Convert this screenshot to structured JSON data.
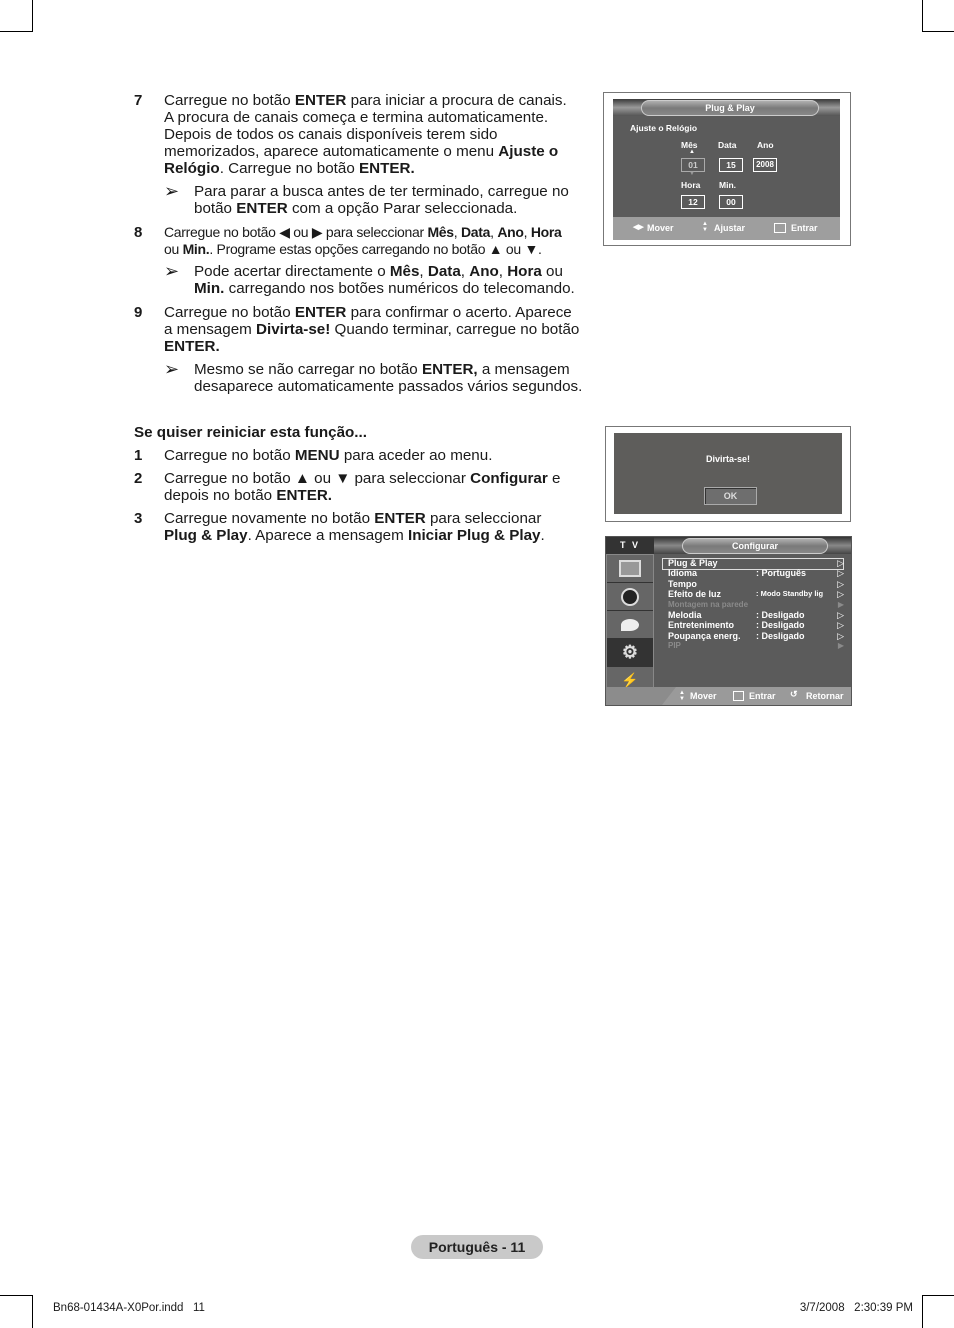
{
  "steps_a": [
    {
      "num": "7",
      "lines": [
        "Carregue no botão <b>ENTER</b> para iniciar a procura de canais.",
        "A procura de canais começa e termina automaticamente.",
        "Depois de todos os canais disponíveis terem sido",
        "memorizados, aparece automaticamente o menu <b>Ajuste o</b>",
        "<b>Relógio</b>. Carregue no botão <b>ENTER.</b>"
      ],
      "note": [
        "Para parar a busca antes de ter terminado, carregue no",
        "botão <b>ENTER</b> com a opção Parar seleccionada."
      ]
    },
    {
      "num": "8",
      "lines": [
        "Carregue no botão ◀ ou ▶ para seleccionar <b>Mês</b>, <b>Data</b>, <b>Ano</b>, <b>Hora</b>",
        "ou <b>Min.</b>. Programe estas opções carregando no botão ▲ ou ▼."
      ],
      "note": [
        "Pode acertar directamente o <b>Mês</b>, <b>Data</b>, <b>Ano</b>, <b>Hora</b> ou",
        "<b>Min.</b> carregando nos botões numéricos do telecomando."
      ]
    },
    {
      "num": "9",
      "lines": [
        "Carregue no botão <b>ENTER</b> para confirmar o acerto. Aparece",
        "a mensagem <b>Divirta-se!</b> Quando terminar, carregue no botão",
        "<b>ENTER.</b>"
      ],
      "note": [
        "Mesmo se não carregar no botão <b>ENTER,</b> a mensagem",
        "desaparece automaticamente passados vários segundos."
      ]
    }
  ],
  "section_b": {
    "heading": "Se quiser reiniciar esta função...",
    "steps": [
      {
        "num": "1",
        "lines": [
          "Carregue no botão <b>MENU</b> para aceder ao menu."
        ]
      },
      {
        "num": "2",
        "lines": [
          "Carregue no botão ▲ ou ▼ para seleccionar <b>Configurar</b> e",
          "depois no botão <b>ENTER.</b>"
        ]
      },
      {
        "num": "3",
        "lines": [
          "Carregue novamente no botão <b>ENTER</b> para seleccionar",
          "<b>Plug &amp; Play</b>. Aparece a mensagem <b>Iniciar Plug &amp; Play</b>."
        ]
      }
    ]
  },
  "clock_osd": {
    "title": "Plug & Play",
    "subtitle": "Ajuste o Relógio",
    "fields": {
      "mes_label": "Mês",
      "mes_value": "01",
      "data_label": "Data",
      "data_value": "15",
      "ano_label": "Ano",
      "ano_value": "2008",
      "hora_label": "Hora",
      "hora_value": "12",
      "min_label": "Min.",
      "min_value": "00"
    },
    "footer": {
      "move": "Mover",
      "adjust": "Ajustar",
      "enter": "Entrar"
    }
  },
  "message_osd": {
    "message": "Divirta-se!",
    "ok": "OK"
  },
  "setup_osd": {
    "source": "T V",
    "title": "Configurar",
    "items": [
      {
        "label": "Plug & Play",
        "value": "",
        "enabled": true,
        "selected": true
      },
      {
        "label": "Idioma",
        "value": ": Português",
        "enabled": true
      },
      {
        "label": "Tempo",
        "value": "",
        "enabled": true
      },
      {
        "label": "Efeito de luz",
        "value": ": Modo Standby lig",
        "enabled": true
      },
      {
        "label": "Montagem na parede",
        "value": "",
        "enabled": false
      },
      {
        "label": "Melodia",
        "value": ": Desligado",
        "enabled": true
      },
      {
        "label": "Entretenimento",
        "value": ": Desligado",
        "enabled": true
      },
      {
        "label": "Poupança energ.",
        "value": ": Desligado",
        "enabled": true
      },
      {
        "label": "PIP",
        "value": "",
        "enabled": false
      }
    ],
    "sidebar_icons": [
      "picture-icon",
      "sound-icon",
      "channel-icon",
      "setup-icon",
      "input-icon"
    ],
    "footer": {
      "move": "Mover",
      "enter": "Entrar",
      "return": "Retornar"
    }
  },
  "page_badge": "Português - 11",
  "print_footer": {
    "file": "Bn68-01434A-X0Por.indd   11",
    "timestamp": "3/7/2008   2:30:39 PM"
  }
}
